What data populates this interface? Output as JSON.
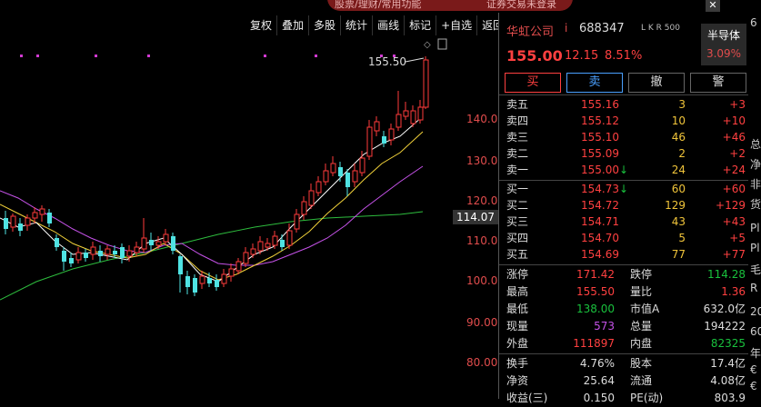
{
  "top_banner": {
    "left_text": "股票/理财/常用功能",
    "right_text": "证券交易未登录"
  },
  "toolbar": {
    "items": [
      "复权",
      "叠加",
      "多股",
      "统计",
      "画线",
      "标记",
      "+自选",
      "返回"
    ]
  },
  "chart": {
    "price_axis_labels": [
      "140.00",
      "130.00",
      "120.00",
      "110.00",
      "100.00",
      "90.00",
      "80.00"
    ],
    "current_price_tag": "114.07",
    "high_annotation": "155.50",
    "colors": {
      "up": "#ff3b3b",
      "down": "#4fe3e3",
      "ma5": "#ffffff",
      "ma10": "#f2d23a",
      "ma20": "#c552e8",
      "ma60": "#2ebd3e",
      "price_tag_bg": "#333333"
    }
  },
  "chart_data": {
    "type": "candlestick",
    "series": [
      "candles",
      "ma5",
      "ma10",
      "ma20",
      "ma60"
    ],
    "price_axis": [
      140,
      130,
      120,
      110,
      100,
      90,
      80
    ],
    "last_high": 155.5
  },
  "stock": {
    "name": "华虹公司",
    "badge": "i",
    "code": "688347",
    "tag": "L K R 500",
    "price": "155.00",
    "change": "12.15",
    "change_pct": "8.51%",
    "sector": "半导体",
    "sector_pct": "3.09%"
  },
  "trade_buttons": {
    "buy": "买",
    "sell": "卖",
    "cancel": "撤",
    "alert": "警"
  },
  "order_book": {
    "asks": [
      {
        "label": "卖五",
        "price": "155.16",
        "arrow": "",
        "volume": "3",
        "change": "+3"
      },
      {
        "label": "卖四",
        "price": "155.12",
        "arrow": "",
        "volume": "10",
        "change": "+10"
      },
      {
        "label": "卖三",
        "price": "155.10",
        "arrow": "",
        "volume": "46",
        "change": "+46"
      },
      {
        "label": "卖二",
        "price": "155.09",
        "arrow": "",
        "volume": "2",
        "change": "+2"
      },
      {
        "label": "卖一",
        "price": "155.00",
        "arrow": "↓",
        "volume": "24",
        "change": "+24"
      }
    ],
    "bids": [
      {
        "label": "买一",
        "price": "154.73",
        "arrow": "↓",
        "volume": "60",
        "change": "+60"
      },
      {
        "label": "买二",
        "price": "154.72",
        "arrow": "",
        "volume": "129",
        "change": "+129"
      },
      {
        "label": "买三",
        "price": "154.71",
        "arrow": "",
        "volume": "43",
        "change": "+43"
      },
      {
        "label": "买四",
        "price": "154.70",
        "arrow": "",
        "volume": "5",
        "change": "+5"
      },
      {
        "label": "买五",
        "price": "154.69",
        "arrow": "",
        "volume": "77",
        "change": "+77"
      }
    ]
  },
  "stats": [
    {
      "l1": "涨停",
      "v1": "171.42",
      "c1": "red",
      "l2": "跌停",
      "v2": "114.28",
      "c2": "green"
    },
    {
      "l1": "最高",
      "v1": "155.50",
      "c1": "red",
      "l2": "量比",
      "v2": "1.36",
      "c2": "red"
    },
    {
      "l1": "最低",
      "v1": "138.00",
      "c1": "green",
      "l2": "市值A",
      "v2": "632.0亿",
      "c2": "white"
    },
    {
      "l1": "现量",
      "v1": "573",
      "c1": "purple",
      "l2": "总量",
      "v2": "194222",
      "c2": "white"
    },
    {
      "l1": "外盘",
      "v1": "111897",
      "c1": "red",
      "l2": "内盘",
      "v2": "82325",
      "c2": "green"
    }
  ],
  "stats2": [
    {
      "l1": "换手",
      "v1": "4.76%",
      "c1": "white",
      "l2": "股本",
      "v2": "17.4亿",
      "c2": "white"
    },
    {
      "l1": "净资",
      "v1": "25.64",
      "c1": "white",
      "l2": "流通",
      "v2": "4.08亿",
      "c2": "white"
    },
    {
      "l1": "收益(三)",
      "v1": "0.150",
      "c1": "white",
      "l2": "PE(动)",
      "v2": "803.9",
      "c2": "white"
    }
  ],
  "edge_labels": [
    "6",
    "总",
    "净",
    "非",
    "货",
    "Pl",
    "Pl",
    "毛",
    "R",
    "20",
    "60",
    "年",
    "€",
    "€",
    "€"
  ]
}
